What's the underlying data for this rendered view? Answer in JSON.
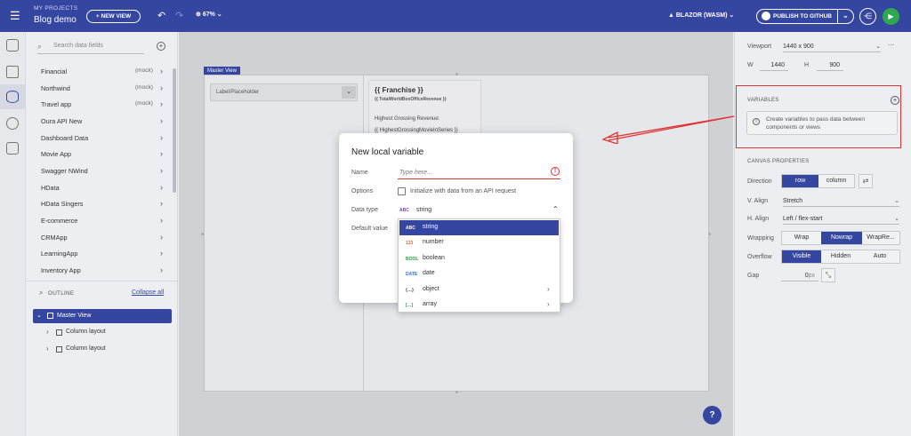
{
  "topbar": {
    "menu_icon": "hamburger-icon",
    "projects_label": "MY PROJECTS",
    "project_name": "Blog demo",
    "new_view_label": "+ NEW VIEW",
    "undo_icon": "undo-icon",
    "redo_icon": "redo-icon",
    "zoom_label": "67%",
    "platform_label": "BLAZOR (WASM)",
    "publish_label": "PUBLISH TO GITHUB",
    "share_icon": "share-icon",
    "play_icon": "play-icon"
  },
  "left": {
    "search_placeholder": "Search data fields",
    "sources": [
      {
        "label": "Financial",
        "mock": "(mock)"
      },
      {
        "label": "Northwind",
        "mock": "(mock)"
      },
      {
        "label": "Travel app",
        "mock": "(mock)"
      },
      {
        "label": "Oura API New",
        "mock": ""
      },
      {
        "label": "Dashboard Data",
        "mock": ""
      },
      {
        "label": "Movie App",
        "mock": ""
      },
      {
        "label": "Swagger NWind",
        "mock": ""
      },
      {
        "label": "HData",
        "mock": ""
      },
      {
        "label": "HData Singers",
        "mock": ""
      },
      {
        "label": "E-commerce",
        "mock": ""
      },
      {
        "label": "CRMApp",
        "mock": ""
      },
      {
        "label": "LearningApp",
        "mock": ""
      },
      {
        "label": "Inventory App",
        "mock": ""
      }
    ],
    "outline_label": "OUTLINE",
    "collapse_label": "Collapse all",
    "tree": [
      {
        "label": "Master View"
      },
      {
        "label": "Column layout"
      },
      {
        "label": "Column layout"
      }
    ]
  },
  "canvas": {
    "master_view_tag": "Master View",
    "placeholder_label": "Label/Placeholder",
    "card_title": "{{ Franchise }}",
    "card_subtitle": "{{ TotalWorldBoxOfficeRevenue }}",
    "card_line1": "Highest Grossing Revenue:",
    "card_line2": "{{ HighestGrossingMovieInSeries }}",
    "help_label": "?"
  },
  "modal": {
    "title": "New local variable",
    "name_label": "Name",
    "name_placeholder": "Type here...",
    "options_label": "Options",
    "options_checkbox_label": "Initialize with data from an API request",
    "data_type_label": "Data type",
    "data_type_tag": "ABC",
    "data_type_value": "string",
    "default_value_label": "Default value",
    "data_type_options": [
      {
        "tag": "ABC",
        "label": "string",
        "color": "#7a3db8"
      },
      {
        "tag": "123",
        "label": "number",
        "color": "#e0632a"
      },
      {
        "tag": "BOOL",
        "label": "boolean",
        "color": "#2f9a3f"
      },
      {
        "tag": "DATE",
        "label": "date",
        "color": "#3b6fd1"
      },
      {
        "tag": "{…}",
        "label": "object",
        "color": "#444444"
      },
      {
        "tag": "[…]",
        "label": "array",
        "color": "#2f9a3f"
      }
    ]
  },
  "right": {
    "viewport_label": "Viewport",
    "viewport_value": "1440 x 900",
    "w_label": "W",
    "w_value": "1440",
    "h_label": "H",
    "h_value": "900",
    "variables_label": "VARIABLES",
    "variables_info": "Create variables to pass data between components or views",
    "canvas_props_label": "CANVAS PROPERTIES",
    "direction_label": "Direction",
    "direction_options": [
      "row",
      "column"
    ],
    "valign_label": "V. Align",
    "valign_value": "Stretch",
    "halign_label": "H. Align",
    "halign_value": "Left / flex-start",
    "wrapping_label": "Wrapping",
    "wrapping_options": [
      "Wrap",
      "Nowrap",
      "WrapRe..."
    ],
    "overflow_label": "Overflow",
    "overflow_options": [
      "Visible",
      "Hidden",
      "Auto"
    ],
    "gap_label": "Gap",
    "gap_value": "0",
    "gap_unit": "px"
  },
  "colors": {
    "brand": "#3546a0",
    "highlight": "#e03232",
    "play": "#2fa84f"
  }
}
